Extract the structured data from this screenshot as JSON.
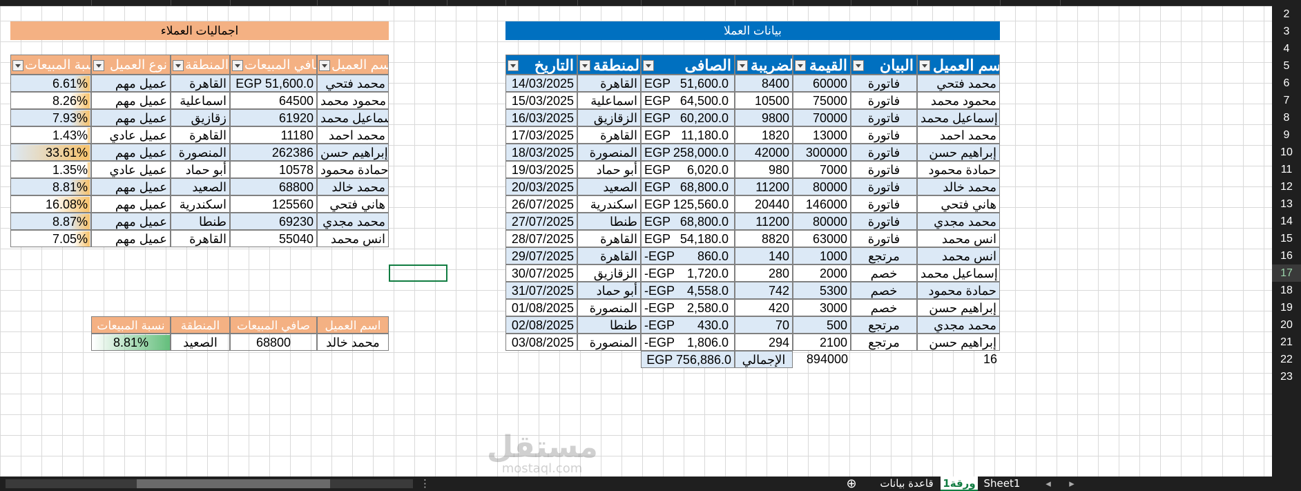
{
  "left_title": "اجماليات العملاء",
  "right_title": "بيانات العملا",
  "right_headers": [
    "اسم العميل",
    "البيان",
    "القيمة",
    "الضريبة",
    "الصافى",
    "المنطقة",
    "التاريخ"
  ],
  "right_rows": [
    {
      "name": "محمد فتحي",
      "type": "فاتورة",
      "value": "60000",
      "tax": "8400",
      "cur": "EGP",
      "net": "51,600.0",
      "region": "القاهرة",
      "date": "14/03/2025"
    },
    {
      "name": "محمود محمد",
      "type": "فاتورة",
      "value": "75000",
      "tax": "10500",
      "cur": "EGP",
      "net": "64,500.0",
      "region": "اسماعلية",
      "date": "15/03/2025"
    },
    {
      "name": "إسماعيل محمد",
      "type": "فاتورة",
      "value": "70000",
      "tax": "9800",
      "cur": "EGP",
      "net": "60,200.0",
      "region": "الزقازيق",
      "date": "16/03/2025"
    },
    {
      "name": "محمد احمد",
      "type": "فاتورة",
      "value": "13000",
      "tax": "1820",
      "cur": "EGP",
      "net": "11,180.0",
      "region": "القاهرة",
      "date": "17/03/2025"
    },
    {
      "name": "إبراهيم حسن",
      "type": "فاتورة",
      "value": "300000",
      "tax": "42000",
      "cur": "EGP",
      "net": "258,000.0",
      "region": "المنصورة",
      "date": "18/03/2025"
    },
    {
      "name": "حمادة محمود",
      "type": "فاتورة",
      "value": "7000",
      "tax": "980",
      "cur": "EGP",
      "net": "6,020.0",
      "region": "أبو حماد",
      "date": "19/03/2025"
    },
    {
      "name": "محمد خالد",
      "type": "فاتورة",
      "value": "80000",
      "tax": "11200",
      "cur": "EGP",
      "net": "68,800.0",
      "region": "الصعيد",
      "date": "20/03/2025"
    },
    {
      "name": "هاني فتحي",
      "type": "فاتورة",
      "value": "146000",
      "tax": "20440",
      "cur": "EGP",
      "net": "125,560.0",
      "region": "اسكندرية",
      "date": "26/07/2025"
    },
    {
      "name": "محمد مجدي",
      "type": "فاتورة",
      "value": "80000",
      "tax": "11200",
      "cur": "EGP",
      "net": "68,800.0",
      "region": "طنطا",
      "date": "27/07/2025"
    },
    {
      "name": "انس محمد",
      "type": "فاتورة",
      "value": "63000",
      "tax": "8820",
      "cur": "EGP",
      "net": "54,180.0",
      "region": "القاهرة",
      "date": "28/07/2025"
    },
    {
      "name": "انس محمد",
      "type": "مرتجع",
      "value": "1000",
      "tax": "140",
      "cur": "-EGP",
      "net": "860.0",
      "region": "القاهرة",
      "date": "29/07/2025"
    },
    {
      "name": "إسماعيل محمد",
      "type": "خصم",
      "value": "2000",
      "tax": "280",
      "cur": "-EGP",
      "net": "1,720.0",
      "region": "الزقازيق",
      "date": "30/07/2025"
    },
    {
      "name": "حمادة محمود",
      "type": "خصم",
      "value": "5300",
      "tax": "742",
      "cur": "-EGP",
      "net": "4,558.0",
      "region": "أبو حماد",
      "date": "31/07/2025"
    },
    {
      "name": "إبراهيم حسن",
      "type": "خصم",
      "value": "3000",
      "tax": "420",
      "cur": "-EGP",
      "net": "2,580.0",
      "region": "المنصورة",
      "date": "01/08/2025"
    },
    {
      "name": "محمد مجدي",
      "type": "مرتجع",
      "value": "500",
      "tax": "70",
      "cur": "-EGP",
      "net": "430.0",
      "region": "طنطا",
      "date": "02/08/2025"
    },
    {
      "name": "إبراهيم حسن",
      "type": "مرتجع",
      "value": "2100",
      "tax": "294",
      "cur": "-EGP",
      "net": "1,806.0",
      "region": "المنصورة",
      "date": "03/08/2025"
    }
  ],
  "right_totals": {
    "count": "16",
    "value": "894000",
    "label": "الإجمالي",
    "net": "EGP 756,886.0"
  },
  "left_headers": [
    "اسم العميل",
    "صافي المبيعات",
    "المنطقة",
    "نوع العميل",
    "نسبة المبيعات"
  ],
  "left_rows": [
    {
      "name": "محمد فتحي",
      "net": "EGP 51,600.0",
      "region": "القاهرة",
      "ctype": "عميل مهم",
      "pct": "6.61%",
      "pv": 6.61
    },
    {
      "name": "محمود محمد",
      "net": "64500",
      "region": "اسماعلية",
      "ctype": "عميل مهم",
      "pct": "8.26%",
      "pv": 8.26
    },
    {
      "name": "إسماعيل محمد",
      "net": "61920",
      "region": "زقازيق",
      "ctype": "عميل مهم",
      "pct": "7.93%",
      "pv": 7.93
    },
    {
      "name": "محمد احمد",
      "net": "11180",
      "region": "القاهرة",
      "ctype": "عميل عادي",
      "pct": "1.43%",
      "pv": 1.43
    },
    {
      "name": "إبراهيم حسن",
      "net": "262386",
      "region": "المنصورة",
      "ctype": "عميل مهم",
      "pct": "33.61%",
      "pv": 33.61
    },
    {
      "name": "حمادة محمود",
      "net": "10578",
      "region": "أبو حماد",
      "ctype": "عميل عادي",
      "pct": "1.35%",
      "pv": 1.35
    },
    {
      "name": "محمد خالد",
      "net": "68800",
      "region": "الصعيد",
      "ctype": "عميل مهم",
      "pct": "8.81%",
      "pv": 8.81
    },
    {
      "name": "هاني فتحي",
      "net": "125560",
      "region": "اسكندرية",
      "ctype": "عميل مهم",
      "pct": "16.08%",
      "pv": 16.08
    },
    {
      "name": "محمد مجدي",
      "net": "69230",
      "region": "طنطا",
      "ctype": "عميل مهم",
      "pct": "8.87%",
      "pv": 8.87
    },
    {
      "name": "انس محمد",
      "net": "55040",
      "region": "القاهرة",
      "ctype": "عميل مهم",
      "pct": "7.05%",
      "pv": 7.05
    }
  ],
  "lookup_headers": [
    "اسم العميل",
    "صافي المبيعات",
    "المنطقة",
    "نسبة المبيعات"
  ],
  "lookup_row": {
    "name": "محمد خالد",
    "net": "68800",
    "region": "الصعيد",
    "pct": "8.81%",
    "pv": 8.81
  },
  "row_numbers": [
    "2",
    "3",
    "4",
    "5",
    "6",
    "7",
    "8",
    "9",
    "10",
    "11",
    "12",
    "13",
    "14",
    "15",
    "16",
    "17",
    "18",
    "19",
    "20",
    "21",
    "22",
    "23"
  ],
  "selected_row": "17",
  "sheet_tabs": [
    "Sheet1",
    "ورقة1",
    "قاعدة بيانات"
  ],
  "active_tab": "ورقة1",
  "watermark": "مستقل",
  "watermark_sub": "mostaql.com",
  "colors": {
    "blue_header": "#0070c0",
    "orange_header": "#f4b183",
    "band": "#dce9f6",
    "databar_orange": "#f7c26b",
    "databar_green": "#63be7b",
    "active_green": "#107c41"
  }
}
